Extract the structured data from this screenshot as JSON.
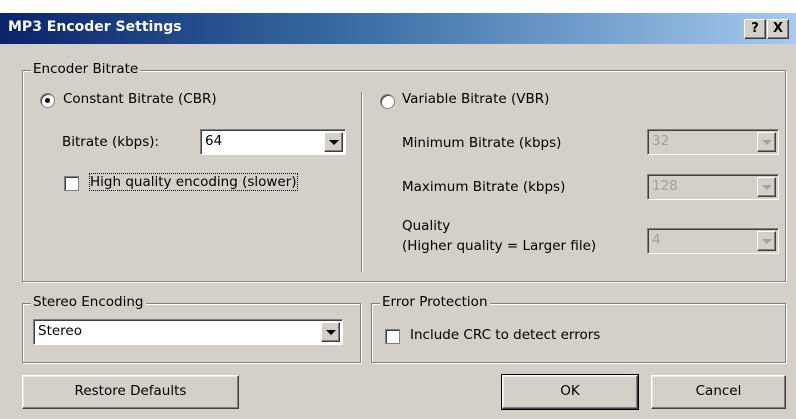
{
  "window": {
    "title": "MP3 Encoder Settings",
    "help_label": "?",
    "close_label": "X"
  },
  "encoder_bitrate": {
    "legend": "Encoder Bitrate",
    "cbr": {
      "label": "Constant Bitrate (CBR)",
      "selected": true,
      "bitrate_label": "Bitrate (kbps):",
      "bitrate_value": "64",
      "hq_label": "High quality encoding (slower)",
      "hq_checked": false
    },
    "vbr": {
      "label": "Variable Bitrate (VBR)",
      "selected": false,
      "min_label": "Minimum Bitrate (kbps)",
      "min_value": "32",
      "max_label": "Maximum Bitrate (kbps)",
      "max_value": "128",
      "quality_label_1": "Quality",
      "quality_label_2": "(Higher quality = Larger file)",
      "quality_value": "4"
    }
  },
  "stereo": {
    "legend": "Stereo Encoding",
    "value": "Stereo"
  },
  "error_protection": {
    "legend": "Error Protection",
    "crc_label": "Include CRC to detect errors",
    "crc_checked": false
  },
  "buttons": {
    "restore": "Restore Defaults",
    "ok": "OK",
    "cancel": "Cancel"
  }
}
